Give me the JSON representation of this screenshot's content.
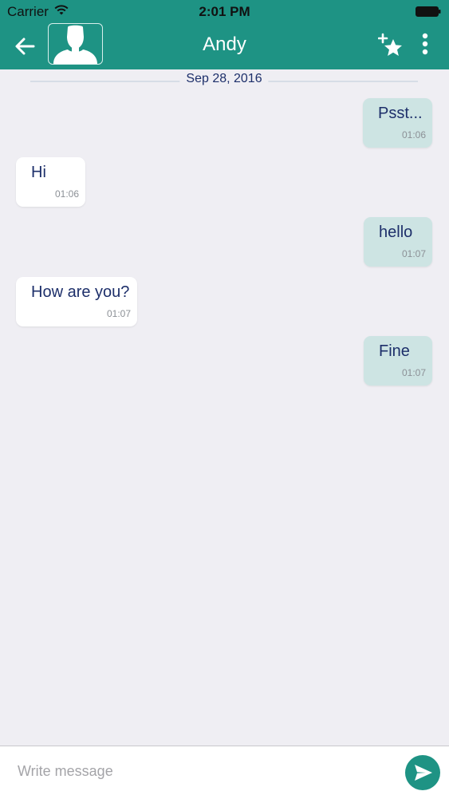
{
  "status_bar": {
    "carrier": "Carrier",
    "time": "2:01 PM"
  },
  "nav": {
    "title": "Andy",
    "icons": [
      "back-arrow-icon",
      "avatar-placeholder",
      "add-favorite-star-icon",
      "more-vertical-icon"
    ]
  },
  "chat": {
    "date_label": "Sep 28, 2016",
    "messages": [
      {
        "text": "Psst...",
        "time": "01:06",
        "direction": "outgoing"
      },
      {
        "text": "Hi",
        "time": "01:06",
        "direction": "incoming"
      },
      {
        "text": "hello",
        "time": "01:07",
        "direction": "outgoing"
      },
      {
        "text": "How are you?",
        "time": "01:07",
        "direction": "incoming"
      },
      {
        "text": "Fine",
        "time": "01:07",
        "direction": "outgoing"
      }
    ]
  },
  "composer": {
    "placeholder": "Write message",
    "value": ""
  },
  "colors": {
    "header": "#1e9384",
    "background": "#efeef3",
    "outgoing_bubble": "#cde4e3",
    "incoming_bubble": "#ffffff",
    "text_primary": "#1d2f6a",
    "timestamp": "#8c9096"
  }
}
